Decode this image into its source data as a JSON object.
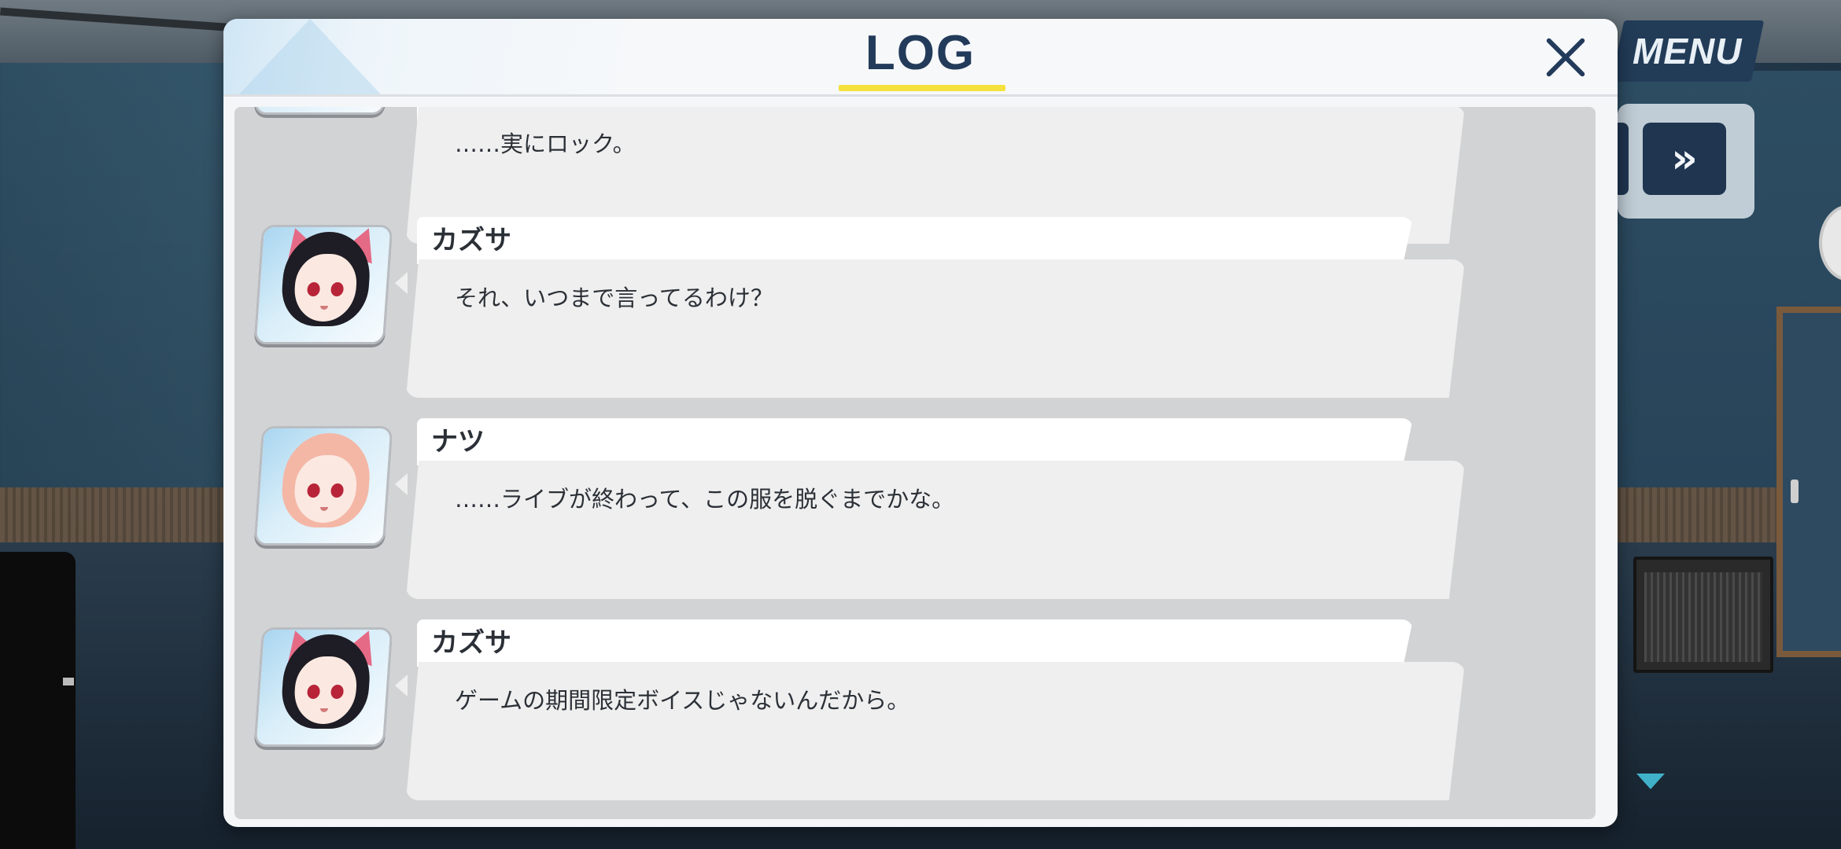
{
  "hud": {
    "menu_label": "MENU",
    "fast_forward_icon": "fast-forward-icon",
    "scroll_indicator_icon": "triangle-down-icon"
  },
  "log": {
    "title": "LOG",
    "close_icon": "close-icon",
    "accent_color": "#f5e13c",
    "entries": [
      {
        "speaker": "",
        "text": "……実にロック。",
        "character": "natsu"
      },
      {
        "speaker": "カズサ",
        "text": "それ、いつまで言ってるわけ？",
        "character": "kazusa"
      },
      {
        "speaker": "ナツ",
        "text": "……ライブが終わって、この服を脱ぐまでかな。",
        "character": "natsu"
      },
      {
        "speaker": "カズサ",
        "text": "ゲームの期間限定ボイスじゃないんだから。",
        "character": "kazusa"
      }
    ]
  }
}
